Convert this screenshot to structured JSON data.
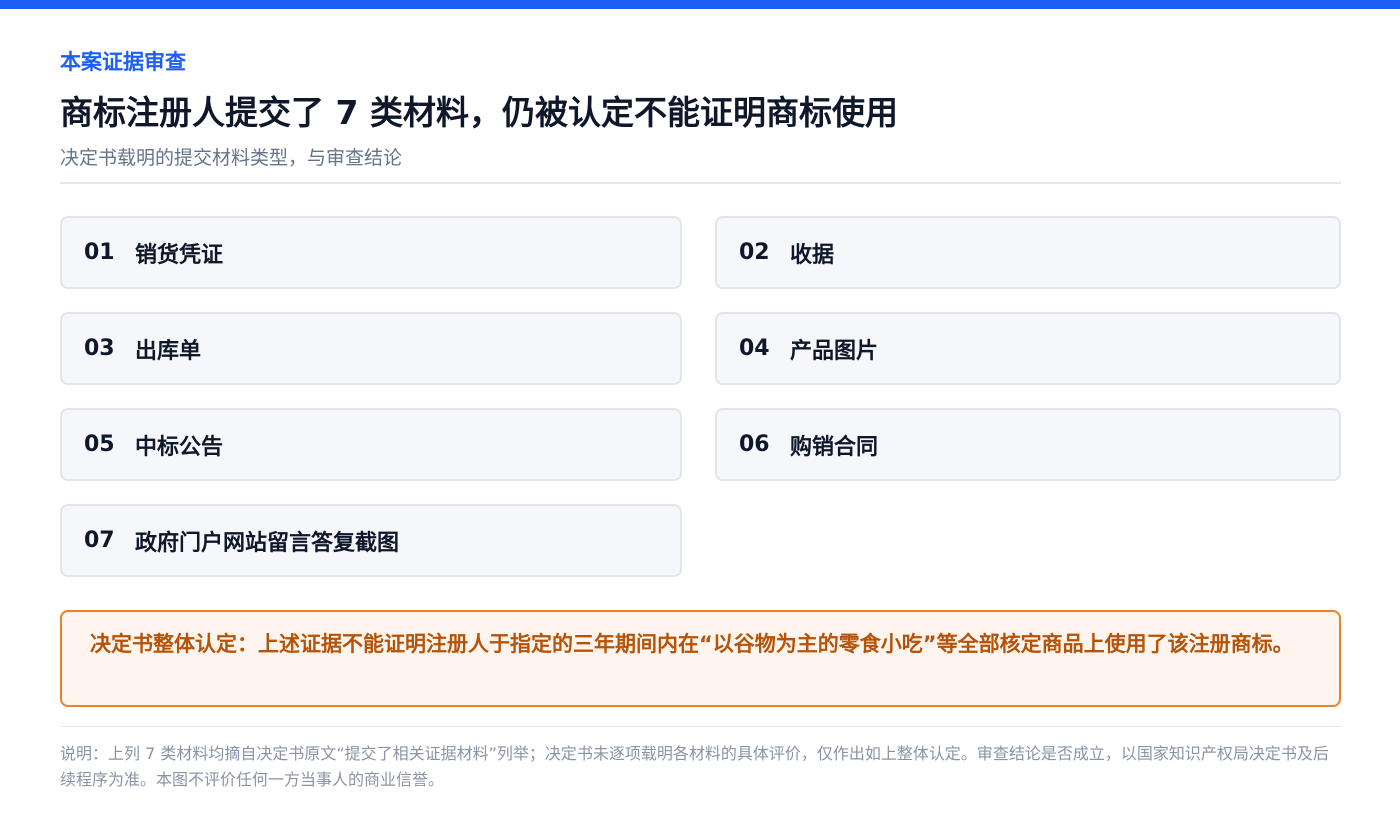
{
  "header": {
    "eyebrow": "本案证据审查",
    "title": "商标注册人提交了 7 类材料，仍被认定不能证明商标使用",
    "subtitle": "决定书载明的提交材料类型，与审查结论"
  },
  "materials": [
    {
      "num": "01",
      "label": "销货凭证"
    },
    {
      "num": "02",
      "label": "收据"
    },
    {
      "num": "03",
      "label": "出库单"
    },
    {
      "num": "04",
      "label": "产品图片"
    },
    {
      "num": "05",
      "label": "中标公告"
    },
    {
      "num": "06",
      "label": "购销合同"
    },
    {
      "num": "07",
      "label": "政府门户网站留言答复截图"
    }
  ],
  "conclusion": "决定书整体认定：上述证据不能证明注册人于指定的三年期间内在“以谷物为主的零食小吃”等全部核定商品上使用了该注册商标。",
  "footnote": "说明：上列 7 类材料均摘自决定书原文“提交了相关证据材料”列举；决定书未逐项载明各材料的具体评价，仅作出如上整体认定。审查结论是否成立，以国家知识产权局决定书及后续程序为准。本图不评价任何一方当事人的商业信誉。",
  "colors": {
    "accent": "#1d5ff5",
    "warning_border": "#e8822a",
    "warning_text": "#b45309",
    "warning_bg": "#fff5ee"
  }
}
